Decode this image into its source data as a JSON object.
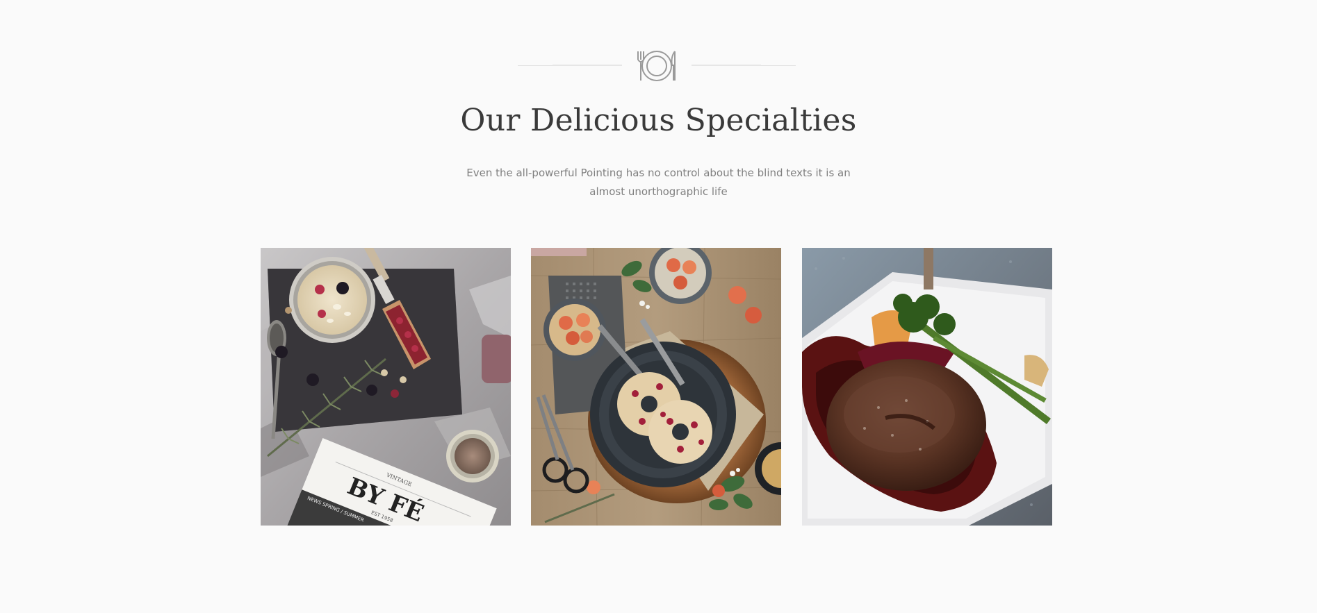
{
  "section": {
    "ornament_icon": "plate-fork-knife-icon",
    "title": "Our Delicious Specialties",
    "subtitle": "Even the all-powerful Pointing has no control about the blind texts it is an almost unorthographic life"
  },
  "gallery": {
    "items": [
      {
        "name": "breakfast-bowl-photo",
        "badge_top": "VINTAGE",
        "badge_main": "BY FÉ",
        "badge_mid": "EST 1958",
        "badge_bottom": "NEWS SPRING / SUMMER"
      },
      {
        "name": "bagel-plate-photo"
      },
      {
        "name": "steak-plate-photo"
      }
    ]
  },
  "colors": {
    "background": "#fafafa",
    "title": "#3a3a3a",
    "subtitle": "#808080",
    "ornament": "#9a9a9a"
  }
}
